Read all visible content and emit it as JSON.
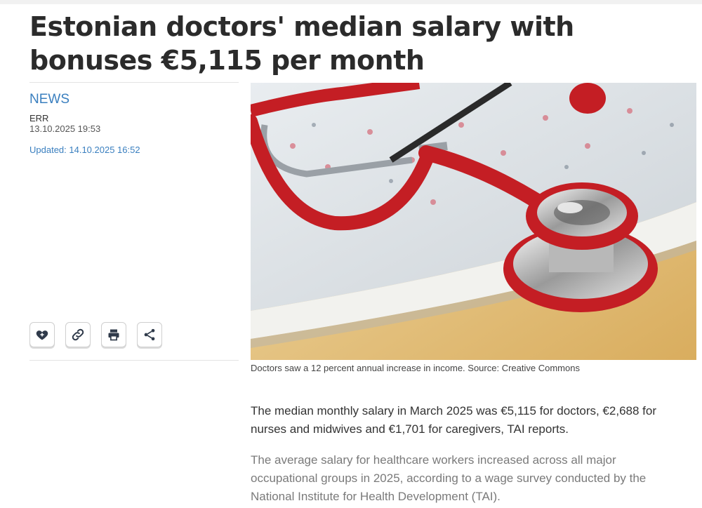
{
  "article": {
    "title": "Estonian doctors' median salary with bonuses €5,115 per month",
    "category": "NEWS",
    "author": "ERR",
    "published": "13.10.2025 19:53",
    "updated": "Updated: 14.10.2025 16:52",
    "image_caption": "Doctors saw a 12 percent annual increase in income. Source: Creative Commons",
    "lead": "The median monthly salary in March 2025 was €5,115 for doctors, €2,688 for nurses and midwives and €1,701 for caregivers, TAI reports.",
    "paragraph_1": "The average salary for healthcare workers increased across all major occupational groups in 2025, according to a wage survey conducted by the National Institute for Health Development (TAI)."
  },
  "actions": [
    {
      "icon": "heart-icon"
    },
    {
      "icon": "link-icon"
    },
    {
      "icon": "print-icon"
    },
    {
      "icon": "share-icon"
    }
  ],
  "colors": {
    "accent": "#3a7fbf",
    "title": "#2b2b2b",
    "stethoscope": "#c41e24"
  }
}
